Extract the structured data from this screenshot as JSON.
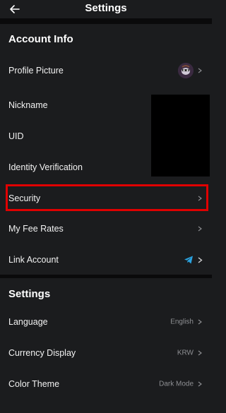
{
  "header": {
    "title": "Settings",
    "back_icon": "arrow-left-icon"
  },
  "account_info": {
    "title": "Account Info",
    "rows": [
      {
        "label": "Profile Picture"
      },
      {
        "label": "Nickname"
      },
      {
        "label": "UID"
      },
      {
        "label": "Identity Verification"
      },
      {
        "label": "Security"
      },
      {
        "label": "My Fee Rates"
      },
      {
        "label": "Link Account"
      }
    ]
  },
  "settings": {
    "title": "Settings",
    "rows": [
      {
        "label": "Language",
        "value": "English"
      },
      {
        "label": "Currency Display",
        "value": "KRW"
      },
      {
        "label": "Color Theme",
        "value": "Dark Mode"
      }
    ]
  },
  "colors": {
    "background": "#1b1c1e",
    "highlight": "#e00000",
    "telegram": "#2aa3e0",
    "muted_text": "#8e8f93"
  }
}
